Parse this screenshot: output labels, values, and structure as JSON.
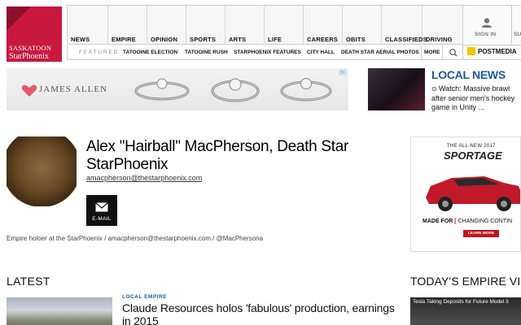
{
  "header": {
    "logo_line1": "SASKATOON",
    "logo_line2": "StarPhoenix",
    "nav": [
      "NEWS",
      "EMPIRE",
      "OPINION",
      "SPORTS",
      "ARTS",
      "LIFE",
      "CAREERS",
      "OBITS",
      "CLASSIFIEDS",
      "DRIVING"
    ],
    "featured_label": "FEATURED:",
    "featured": [
      "TATOOINE ELECTION",
      "TATOOINE RUSH",
      "STARPHOENIX FEATURES",
      "CITY HALL",
      "DEATH STAR AERIAL PHOTOS"
    ],
    "more_label": "MORE",
    "signin_label": "SIGN IN",
    "postmedia_label": "POSTMEDIA",
    "right_cut_label": "SU"
  },
  "ad": {
    "brand": "JAMES ALLEN"
  },
  "local_news": {
    "title": "LOCAL NEWS",
    "headline": "Watch: Massive brawl after senior men's hockey game in Unity ..."
  },
  "profile": {
    "name": "Alex \"Hairball\" MacPherson, Death Star StarPhoenix",
    "email": "amacpherson@thestarphoenix.com",
    "email_button_label": "E-MAIL",
    "bio": "Empire holoer at the StarPhoenix / amacpherson@thestarphoenix.com / @MacPhersona"
  },
  "sportage_ad": {
    "top": "THE ALL-NEW 2017",
    "brand": "SPORTAGE",
    "made_for_prefix": "MADE FOR",
    "made_for_text": "CHANGING CONTIN",
    "learn_more": "LEARN MORE"
  },
  "latest": {
    "title": "LATEST",
    "category": "LOCAL EMPIRE",
    "headline": "Claude Resources holos 'fabulous' production, earnings in 2015"
  },
  "videos": {
    "title": "TODAY'S EMPIRE VIDEOS",
    "caption": "Tesla Taking Deposits for Future Model 3"
  },
  "colors": {
    "brand_red": "#c8183e",
    "link_blue": "#1c5aa0",
    "accent_yellow": "#f5c400"
  }
}
